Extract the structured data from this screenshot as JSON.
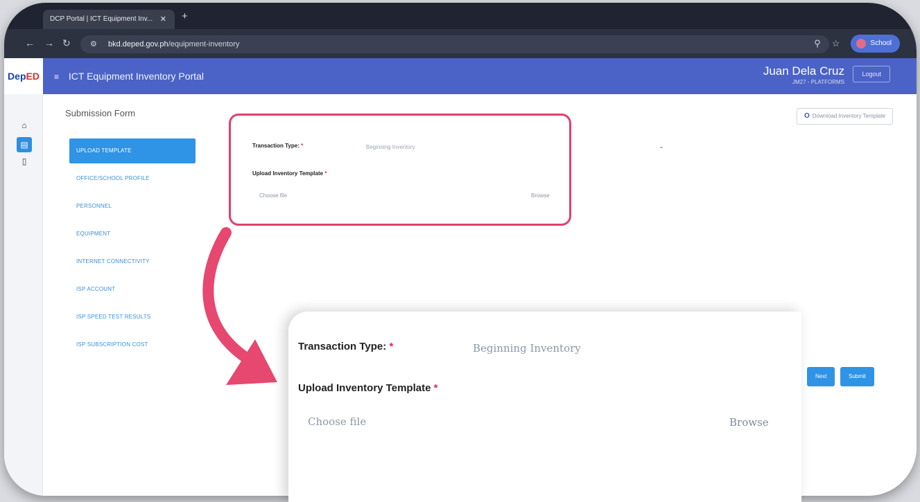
{
  "browser": {
    "tab_title": "DCP Portal | ICT Equipment Inv...",
    "tab_close": "✕",
    "new_tab": "+",
    "url_domain": "bkd.deped.gov.ph",
    "url_path": "/equipment-inventory",
    "profile_label": "School"
  },
  "header": {
    "logo_part1": "Dep",
    "logo_part2": "ED",
    "app_title": "ICT Equipment Inventory Portal",
    "user_name": "Juan Dela Cruz",
    "user_sub": "JM27 - PLATFORMS",
    "logout_label": "Logout"
  },
  "page": {
    "form_title": "Submission Form",
    "download_label": "Download Inventory Template"
  },
  "side_nav": {
    "items": [
      {
        "label": "UPLOAD TEMPLATE",
        "active": true
      },
      {
        "label": "OFFICE/SCHOOL PROFILE",
        "active": false
      },
      {
        "label": "PERSONNEL",
        "active": false
      },
      {
        "label": "EQUIPMENT",
        "active": false
      },
      {
        "label": "INTERNET CONNECTIVITY",
        "active": false
      },
      {
        "label": "ISP ACCOUNT",
        "active": false
      },
      {
        "label": "ISP SPEED TEST RESULTS",
        "active": false
      },
      {
        "label": "ISP SUBSCRIPTION COST",
        "active": false
      }
    ]
  },
  "form": {
    "transaction_type_label": "Transaction Type:",
    "transaction_type_value": "Beginning Inventory",
    "upload_label": "Upload Inventory Template",
    "required_mark": "*",
    "file_placeholder": "Choose file",
    "browse_label": "Browse"
  },
  "actions": {
    "next_label": "Next",
    "submit_label": "Submit"
  },
  "icons": {
    "back": "back-arrow-icon",
    "forward": "forward-arrow-icon",
    "reload": "reload-icon",
    "site_info": "site-info-icon",
    "zoom": "zoom-icon",
    "bookmark": "star-icon",
    "home": "home-icon",
    "document": "document-icon",
    "file": "file-icon",
    "download": "download-icon",
    "caret": "chevron-down-icon",
    "menu": "menu-icon"
  },
  "colors": {
    "header": "#4b63c6",
    "accent": "#2f93e6",
    "highlight": "#e0406a",
    "required": "#e0245e"
  }
}
